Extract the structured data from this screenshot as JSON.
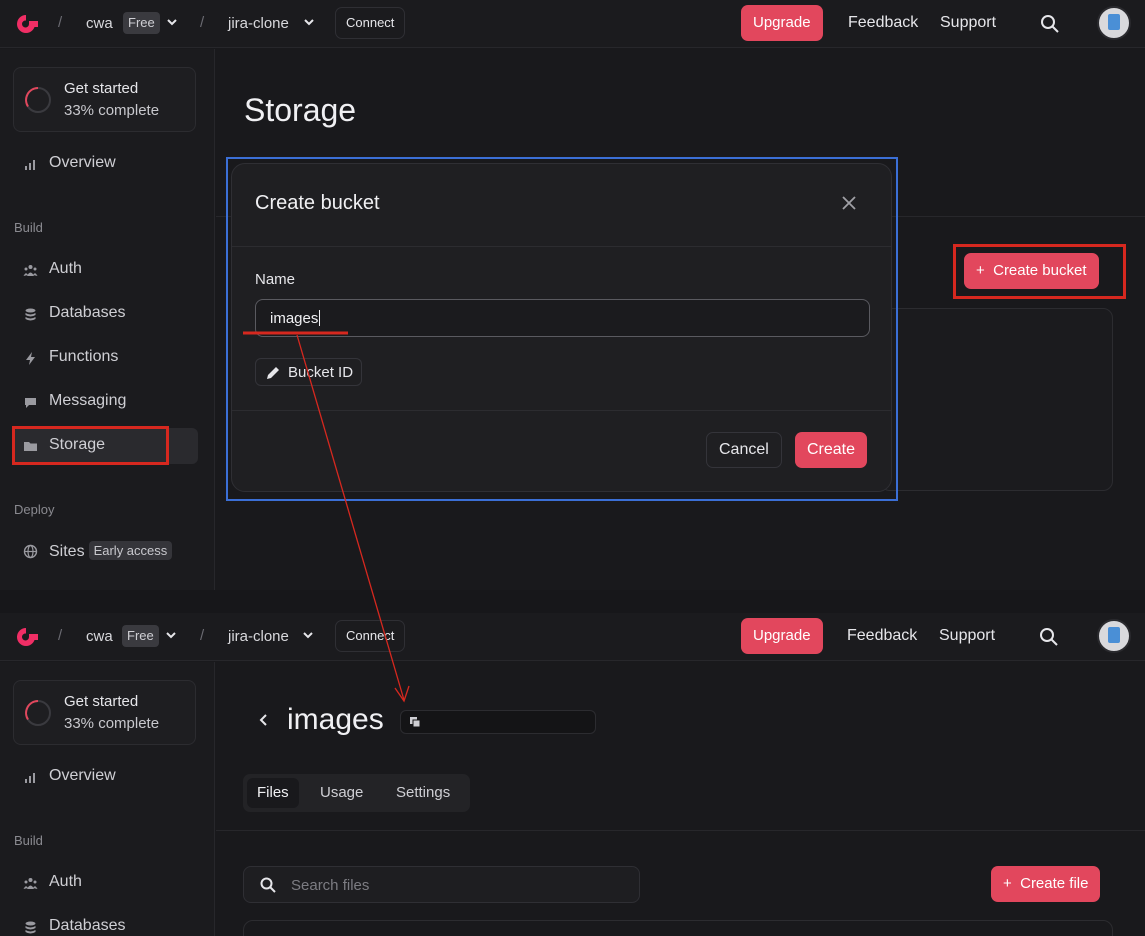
{
  "header": {
    "org_name": "cwa",
    "plan_badge": "Free",
    "project_name": "jira-clone",
    "connect_label": "Connect",
    "upgrade_label": "Upgrade",
    "feedback_label": "Feedback",
    "support_label": "Support"
  },
  "sidebar": {
    "get_started": {
      "title": "Get started",
      "progress_text": "33% complete",
      "progress": 0.33
    },
    "overview_label": "Overview",
    "build_section": "Build",
    "deploy_section": "Deploy",
    "items": [
      {
        "label": "Auth",
        "icon": "users-icon"
      },
      {
        "label": "Databases",
        "icon": "database-icon"
      },
      {
        "label": "Functions",
        "icon": "lightning-icon"
      },
      {
        "label": "Messaging",
        "icon": "chat-icon"
      },
      {
        "label": "Storage",
        "icon": "folder-icon"
      }
    ],
    "sites": {
      "label": "Sites",
      "badge": "Early access"
    }
  },
  "storage_page": {
    "title": "Storage",
    "create_bucket_label": "Create bucket"
  },
  "modal": {
    "title": "Create bucket",
    "name_label": "Name",
    "name_value": "images",
    "bucket_id_label": "Bucket ID",
    "cancel_label": "Cancel",
    "create_label": "Create"
  },
  "bucket_page": {
    "title": "images",
    "tabs": [
      {
        "label": "Files",
        "active": true
      },
      {
        "label": "Usage",
        "active": false
      },
      {
        "label": "Settings",
        "active": false
      }
    ],
    "search_placeholder": "Search files",
    "create_file_label": "Create file"
  },
  "colors": {
    "accent": "#e2475d",
    "annotation_red": "#d6281f",
    "annotation_blue": "#3b6fd6",
    "background": "#19191c"
  }
}
